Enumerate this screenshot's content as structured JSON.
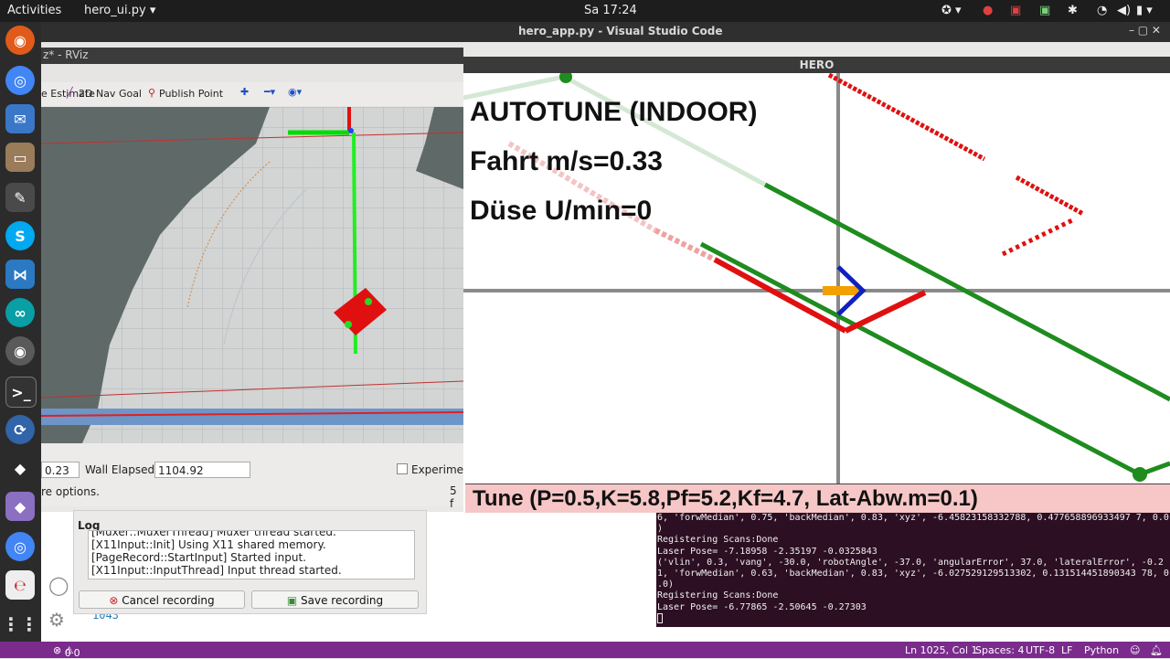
{
  "topbar": {
    "activities": "Activities",
    "app_menu": "hero_ui.py",
    "clock": "Sa 17:24"
  },
  "vscode": {
    "title": "hero_app.py - Visual Studio Code",
    "line_number": "1043"
  },
  "rviz": {
    "title": "z* - RViz",
    "toolbar": {
      "partial": "e Estimate",
      "nav_goal": "2D Nav Goal",
      "publish_point": "Publish Point"
    },
    "status": {
      "time_value": "0.23",
      "wall_elapsed_label": "Wall Elapsed:",
      "wall_elapsed_value": "1104.92",
      "experimental_label": "Experimen",
      "more_options": "re options.",
      "fps": "5 f"
    }
  },
  "hero": {
    "title": "HERO",
    "lines": [
      "AUTOTUNE (INDOOR)",
      "Fahrt m/s=0.33",
      "Düse U/min=0"
    ],
    "tune": "Tune (P=0.5,K=5.8,Pf=5.2,Kf=4.7, Lat-Abw.m=0.1)",
    "colors": {
      "path": "#1e8c1e",
      "robot": "#e01010",
      "marker": "#f2a000",
      "axis": "#1020c0"
    }
  },
  "recorder": {
    "log_label": "Log",
    "log_lines": [
      "[Muxer::MuxerThread] Muxer thread started.",
      "[X11Input::Init] Using X11 shared memory.",
      "[PageRecord::StartInput] Started input.",
      "[X11Input::InputThread] Input thread started."
    ],
    "cancel_label": "Cancel recording",
    "save_label": "Save recording"
  },
  "terminal": {
    "lines": [
      "6, 'forwMedian', 0.75, 'backMedian', 0.83, 'xyz', -6.45823158332788, 0.477658896933497 7, 0.0",
      ")",
      "Registering Scans:Done",
      "Laser Pose= -7.18958 -2.35197 -0.0325843",
      "('vlin', 0.3, 'vang', -30.0, 'robotAngle', -37.0, 'angularError', 37.0, 'lateralError', -0.2",
      "1, 'forwMedian', 0.63, 'backMedian', 0.83, 'xyz', -6.027529129513302, 0.131514451890343 78, 0",
      ".0)",
      "Registering Scans:Done",
      "Laser Pose= -6.77865 -2.50645 -0.27303"
    ]
  },
  "statusbar": {
    "errors": "0",
    "warnings": "0",
    "position": "Ln 1025, Col 1",
    "spaces": "Spaces: 4",
    "encoding": "UTF-8",
    "eol": "LF",
    "language": "Python"
  }
}
